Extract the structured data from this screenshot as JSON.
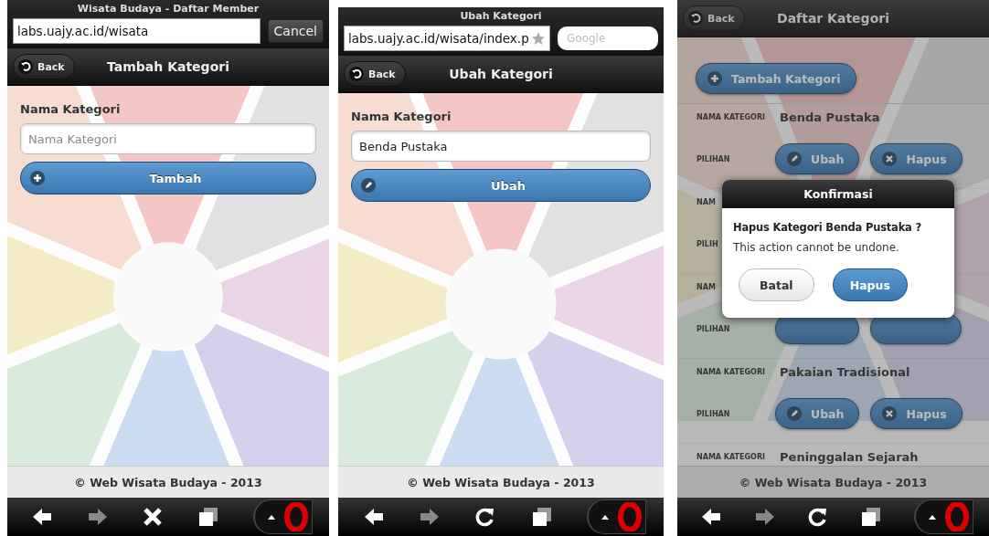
{
  "screens": [
    {
      "browser_bar": {
        "title": "Wisata Budaya - Daftar Member",
        "url": "labs.uajy.ac.id/wisata",
        "cancel": "Cancel"
      },
      "header": {
        "back": "Back",
        "title": "Tambah Kategori"
      },
      "form": {
        "label": "Nama Kategori",
        "placeholder": "Nama Kategori",
        "button": {
          "kind": "add",
          "label": "Tambah"
        }
      },
      "footer": "© Web Wisata Budaya - 2013",
      "toolbar": [
        {
          "kind": "back",
          "disabled": false
        },
        {
          "kind": "forward",
          "disabled": true
        },
        {
          "kind": "stop",
          "disabled": false
        },
        {
          "kind": "tabs",
          "disabled": false
        },
        {
          "kind": "menu",
          "disabled": false
        }
      ]
    },
    {
      "browser_bar": {
        "title": "Ubah Kategori",
        "url": "labs.uajy.ac.id/wisata/index.p",
        "search_placeholder": "Google"
      },
      "header": {
        "back": "Back",
        "title": "Ubah Kategori"
      },
      "form": {
        "label": "Nama Kategori",
        "value": "Benda Pustaka",
        "button": {
          "kind": "edit",
          "label": "Ubah"
        }
      },
      "footer": "© Web Wisata Budaya - 2013",
      "toolbar": [
        {
          "kind": "back",
          "disabled": false
        },
        {
          "kind": "forward",
          "disabled": true
        },
        {
          "kind": "reload",
          "disabled": false
        },
        {
          "kind": "tabs",
          "disabled": false
        },
        {
          "kind": "menu",
          "disabled": false
        }
      ]
    },
    {
      "header": {
        "back": "Back",
        "title": "Daftar Kategori"
      },
      "list": {
        "add_button": {
          "kind": "add",
          "label": "Tambah Kategori"
        },
        "items": [
          {
            "name_label": "NAMA KATEGORI",
            "name": "Benda Pustaka",
            "options_label": "PILIHAN",
            "actions": [
              {
                "kind": "edit",
                "label": "Ubah"
              },
              {
                "kind": "delete",
                "label": "Hapus"
              }
            ]
          },
          {
            "name_label": "NAM",
            "options_label": "PILIH"
          },
          {
            "name_label": "NAM",
            "options_label": "PILIHAN",
            "actions": [
              {
                "kind": "edit"
              },
              {
                "kind": "delete"
              }
            ]
          },
          {
            "name_label": "NAMA KATEGORI",
            "name": "Pakaian Tradisional",
            "options_label": "PILIHAN",
            "actions": [
              {
                "kind": "edit",
                "label": "Ubah"
              },
              {
                "kind": "delete",
                "label": "Hapus"
              }
            ]
          },
          {
            "name_label": "NAMA KATEGORI",
            "name": "Peninggalan Sejarah"
          }
        ]
      },
      "dialog": {
        "title": "Konfirmasi",
        "heading": "Hapus Kategori Benda Pustaka ?",
        "message": "This action cannot be undone.",
        "buttons": [
          {
            "kind": "cancel",
            "label": "Batal"
          },
          {
            "kind": "confirm",
            "label": "Hapus"
          }
        ]
      },
      "footer": "© Web Wisata Budaya - 2013",
      "toolbar": [
        {
          "kind": "back",
          "disabled": false
        },
        {
          "kind": "forward",
          "disabled": true
        },
        {
          "kind": "reload",
          "disabled": false
        },
        {
          "kind": "tabs",
          "disabled": false
        },
        {
          "kind": "menu",
          "disabled": false
        }
      ]
    }
  ]
}
